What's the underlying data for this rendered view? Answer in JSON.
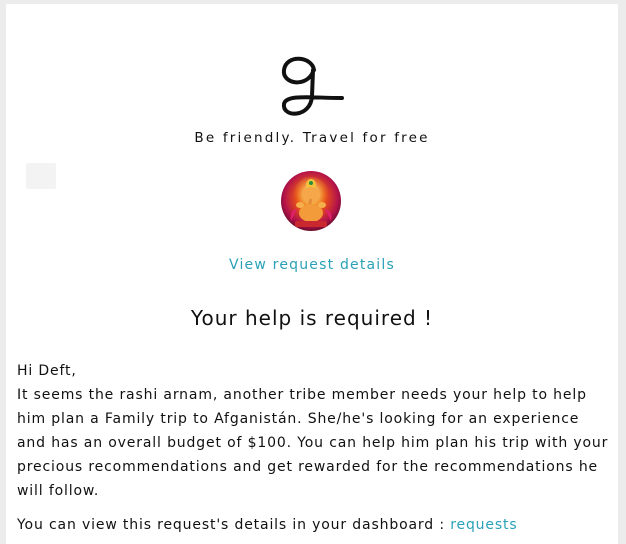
{
  "brand": {
    "logo_letter": "g",
    "tagline": "Be friendly. Travel for free"
  },
  "request": {
    "avatar_icon": "ganesha-avatar-icon",
    "view_details_label": "View request details"
  },
  "message": {
    "headline": "Your help is required !",
    "greeting": "Hi Deft,",
    "body": "It seems the rashi arnam, another tribe member needs your help to help him plan a Family trip to Afganistán. She/he's looking for an experience and has an overall budget of $100. You can help him plan his trip with your precious recommendations and get rewarded for the recommendations he will follow.",
    "dashboard_text": "You can view this request's details in your dashboard : ",
    "dashboard_link_label": "requests"
  },
  "colors": {
    "link": "#2aa1b7",
    "page_background": "#ececec",
    "card_background": "#ffffff",
    "text": "#111111"
  }
}
